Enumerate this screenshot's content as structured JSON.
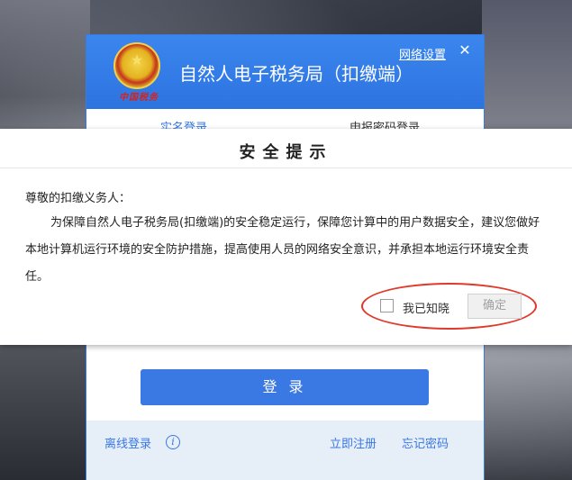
{
  "login": {
    "title": "自然人电子税务局（扣缴端）",
    "net_settings": "网络设置",
    "close": "✕",
    "emblem_caption": "中国税务",
    "tabs": [
      {
        "label": "实名登录"
      },
      {
        "label": "申报密码登录"
      }
    ],
    "login_button": "登 录",
    "footer": {
      "offline_login": "离线登录",
      "info": "i",
      "register": "立即注册",
      "forgot_password": "忘记密码"
    }
  },
  "dialog": {
    "title": "安全提示",
    "salutation": "尊敬的扣缴义务人：",
    "body": "为保障自然人电子税务局(扣缴端)的安全稳定运行，保障您计算中的用户数据安全，建议您做好本地计算机运行环境的安全防护措施，提高使用人员的网络安全意识，并承担本地运行环境安全责任。",
    "ack_label": "我已知晓",
    "ack_checked": false,
    "confirm_button": "确定"
  },
  "colors": {
    "brand_blue": "#2d73e0",
    "highlight_red": "#e03a2a"
  }
}
